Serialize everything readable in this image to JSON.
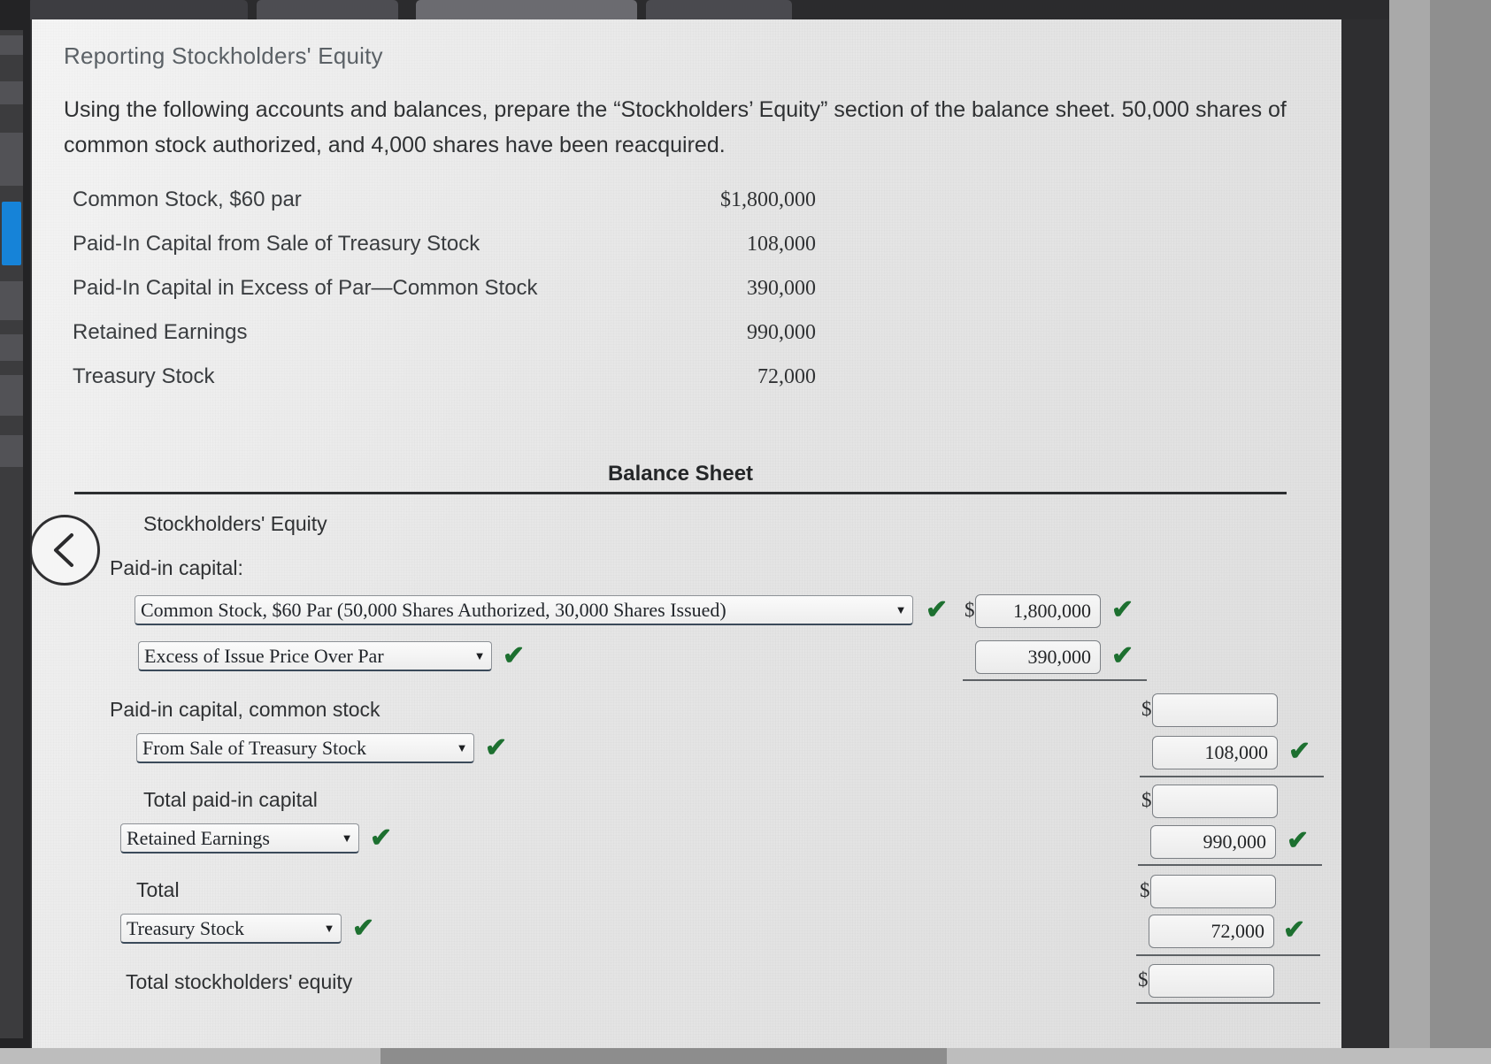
{
  "question": {
    "title": "Reporting Stockholders' Equity",
    "prompt": "Using the following accounts and balances, prepare the “Stockholders’ Equity” section of the balance sheet. 50,000 shares of common stock authorized, and 4,000 shares have been reacquired."
  },
  "accounts": [
    {
      "name": "Common Stock, $60 par",
      "amount": "$1,800,000"
    },
    {
      "name": "Paid-In Capital from Sale of Treasury Stock",
      "amount": "108,000"
    },
    {
      "name": "Paid-In Capital in Excess of Par—Common Stock",
      "amount": "390,000"
    },
    {
      "name": "Retained Earnings",
      "amount": "990,000"
    },
    {
      "name": "Treasury Stock",
      "amount": "72,000"
    }
  ],
  "balance_sheet": {
    "title": "Balance Sheet",
    "section_heading": "Stockholders' Equity",
    "paid_in_capital_label": "Paid-in capital:",
    "rows": {
      "common_stock_select": "Common Stock, $60 Par (50,000 Shares Authorized, 30,000 Shares Issued)",
      "excess_select": "Excess of Issue Price Over Par",
      "paid_in_capital_common_stock": "Paid-in capital, common stock",
      "from_sale_select": "From Sale of Treasury Stock",
      "total_paid_in_capital": "Total paid-in capital",
      "retained_earnings_select": "Retained Earnings",
      "total": "Total",
      "treasury_stock_select": "Treasury Stock",
      "total_stockholders_equity": "Total stockholders' equity"
    },
    "values": {
      "common_stock_amount": "1,800,000",
      "excess_amount": "390,000",
      "paid_in_capital_common_total": "",
      "from_sale_amount": "108,000",
      "total_paid_in_capital_amount": "",
      "retained_earnings_amount": "990,000",
      "total_amount": "",
      "treasury_stock_amount": "72,000",
      "total_equity_amount": ""
    },
    "currency_symbol": "$",
    "caret_glyph": "▼",
    "check_glyph": "✔",
    "check_color": "#1d7030"
  }
}
